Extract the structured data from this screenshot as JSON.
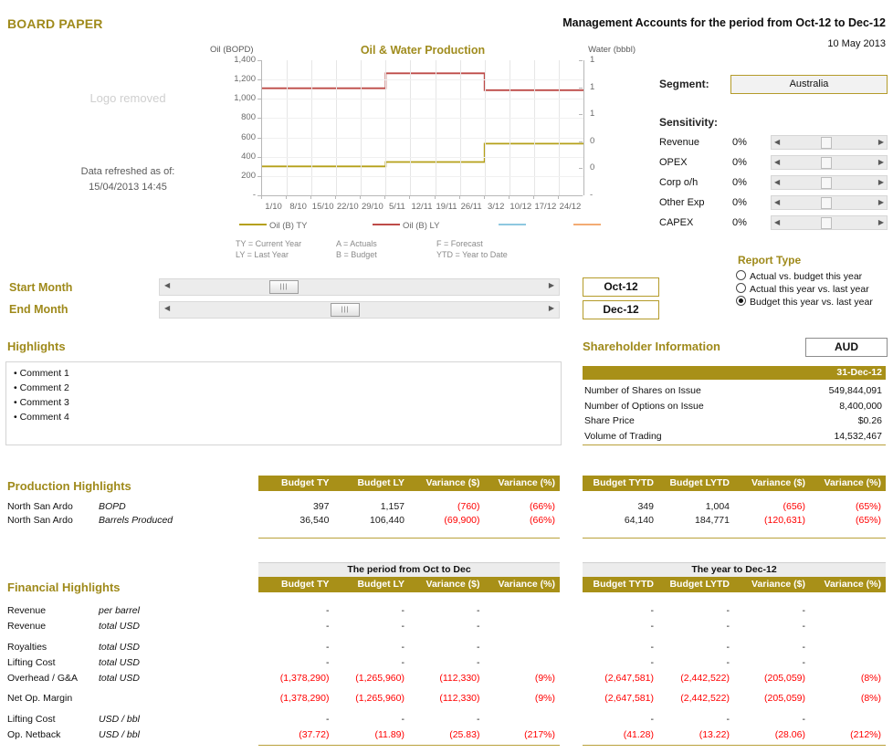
{
  "header": {
    "board_paper": "BOARD PAPER",
    "title": "Management Accounts for the period from Oct-12 to Dec-12",
    "date": "10 May 2013",
    "logo_placeholder": "Logo removed",
    "refresh_label": "Data refreshed as of:",
    "refresh_value": "15/04/2013  14:45"
  },
  "chart_data": {
    "type": "line",
    "title": "Oil & Water Production",
    "ylabel": "Oil (BOPD)",
    "y2label": "Water (bbbl)",
    "xlabel": "",
    "grid": true,
    "legend_position": "bottom",
    "ylim": [
      0,
      1400
    ],
    "yticks": [
      "1,400",
      "1,200",
      "1,000",
      "800",
      "600",
      "400",
      "200",
      "-"
    ],
    "y2ticks": [
      "1",
      "1",
      "1",
      "0",
      "0",
      "-"
    ],
    "x": [
      "1/10",
      "8/10",
      "15/10",
      "22/10",
      "29/10",
      "5/11",
      "12/11",
      "19/11",
      "26/11",
      "3/12",
      "10/12",
      "17/12",
      "24/12"
    ],
    "series": [
      {
        "name": "Oil (B) TY",
        "color": "#b5a019",
        "values": [
          300,
          300,
          300,
          300,
          300,
          345,
          345,
          345,
          345,
          535,
          535,
          535,
          535
        ]
      },
      {
        "name": "Oil (B) LY",
        "color": "#be4b48",
        "values": [
          1110,
          1110,
          1110,
          1110,
          1110,
          1265,
          1265,
          1265,
          1265,
          1090,
          1090,
          1090,
          1090
        ]
      },
      {
        "name": "",
        "color": "#8ec8e0",
        "values": []
      },
      {
        "name": "",
        "color": "#f3ab74",
        "values": []
      }
    ],
    "footnotes": [
      [
        "TY = Current Year",
        "A = Actuals",
        "F = Forecast"
      ],
      [
        "LY = Last Year",
        "B = Budget",
        "YTD = Year to Date"
      ]
    ]
  },
  "controls": {
    "segment_label": "Segment:",
    "segment_value": "Australia",
    "sensitivity_label": "Sensitivity:",
    "sensitivity": [
      {
        "name": "Revenue",
        "value": "0%"
      },
      {
        "name": "OPEX",
        "value": "0%"
      },
      {
        "name": "Corp o/h",
        "value": "0%"
      },
      {
        "name": "Other Exp",
        "value": "0%"
      },
      {
        "name": "CAPEX",
        "value": "0%"
      }
    ],
    "report_type_title": "Report Type",
    "report_types": [
      {
        "label": "Actual vs. budget this year",
        "selected": false
      },
      {
        "label": "Actual this year vs. last year",
        "selected": false
      },
      {
        "label": "Budget this year vs. last year",
        "selected": true
      }
    ],
    "start_month_label": "Start Month",
    "start_month_value": "Oct-12",
    "end_month_label": "End Month",
    "end_month_value": "Dec-12"
  },
  "highlights": {
    "title": "Highlights",
    "items": [
      "• Comment 1",
      "• Comment 2",
      "• Comment 3",
      "• Comment 4"
    ]
  },
  "shareholder": {
    "title": "Shareholder Information",
    "currency": "AUD",
    "as_at": "31-Dec-12",
    "rows": [
      {
        "label": "Number of Shares on Issue",
        "value": "549,844,091"
      },
      {
        "label": "Number of Options on Issue",
        "value": "8,400,000"
      },
      {
        "label": "Share Price",
        "value": "$0.26"
      },
      {
        "label": "Volume of Trading",
        "value": "14,532,467"
      }
    ]
  },
  "production": {
    "title": "Production Highlights",
    "left_headers": [
      "Budget TY",
      "Budget LY",
      "Variance ($)",
      "Variance (%)"
    ],
    "right_headers": [
      "Budget TYTD",
      "Budget LYTD",
      "Variance ($)",
      "Variance (%)"
    ],
    "rows": [
      {
        "label": "North San Ardo",
        "unit": "BOPD",
        "left": [
          "397",
          "1,157",
          "(760)",
          "(66%)"
        ],
        "right": [
          "349",
          "1,004",
          "(656)",
          "(65%)"
        ],
        "left_neg": [
          false,
          false,
          true,
          true
        ],
        "right_neg": [
          false,
          false,
          true,
          true
        ]
      },
      {
        "label": "North San Ardo",
        "unit": "Barrels Produced",
        "left": [
          "36,540",
          "106,440",
          "(69,900)",
          "(66%)"
        ],
        "right": [
          "64,140",
          "184,771",
          "(120,631)",
          "(65%)"
        ],
        "left_neg": [
          false,
          false,
          true,
          true
        ],
        "right_neg": [
          false,
          false,
          true,
          true
        ]
      }
    ]
  },
  "financial": {
    "title": "Financial Highlights",
    "left_band": "The period from Oct to Dec",
    "right_band": "The year to Dec-12",
    "left_headers": [
      "Budget TY",
      "Budget LY",
      "Variance ($)",
      "Variance (%)"
    ],
    "right_headers": [
      "Budget TYTD",
      "Budget LYTD",
      "Variance ($)",
      "Variance (%)"
    ],
    "rows": [
      {
        "label": "Revenue",
        "unit": "per barrel",
        "left": [
          "-",
          "-",
          "-",
          ""
        ],
        "right": [
          "-",
          "-",
          "-",
          ""
        ],
        "left_neg": [
          false,
          false,
          false,
          false
        ],
        "right_neg": [
          false,
          false,
          false,
          false
        ]
      },
      {
        "label": "Revenue",
        "unit": "total USD",
        "left": [
          "-",
          "-",
          "-",
          ""
        ],
        "right": [
          "-",
          "-",
          "-",
          ""
        ],
        "left_neg": [
          false,
          false,
          false,
          false
        ],
        "right_neg": [
          false,
          false,
          false,
          false
        ]
      },
      {
        "label": "Royalties",
        "unit": "total USD",
        "left": [
          "-",
          "-",
          "-",
          ""
        ],
        "right": [
          "-",
          "-",
          "-",
          ""
        ],
        "left_neg": [
          false,
          false,
          false,
          false
        ],
        "right_neg": [
          false,
          false,
          false,
          false
        ]
      },
      {
        "label": "Lifting Cost",
        "unit": "total USD",
        "left": [
          "-",
          "-",
          "-",
          ""
        ],
        "right": [
          "-",
          "-",
          "-",
          ""
        ],
        "left_neg": [
          false,
          false,
          false,
          false
        ],
        "right_neg": [
          false,
          false,
          false,
          false
        ]
      },
      {
        "label": "Overhead / G&A",
        "unit": "total USD",
        "left": [
          "(1,378,290)",
          "(1,265,960)",
          "(112,330)",
          "(9%)"
        ],
        "right": [
          "(2,647,581)",
          "(2,442,522)",
          "(205,059)",
          "(8%)"
        ],
        "left_neg": [
          true,
          true,
          true,
          true
        ],
        "right_neg": [
          true,
          true,
          true,
          true
        ]
      },
      {
        "label": "Net Op. Margin",
        "unit": "",
        "left": [
          "(1,378,290)",
          "(1,265,960)",
          "(112,330)",
          "(9%)"
        ],
        "right": [
          "(2,647,581)",
          "(2,442,522)",
          "(205,059)",
          "(8%)"
        ],
        "left_neg": [
          true,
          true,
          true,
          true
        ],
        "right_neg": [
          true,
          true,
          true,
          true
        ]
      },
      {
        "label": "Lifting Cost",
        "unit": "USD / bbl",
        "left": [
          "-",
          "-",
          "-",
          ""
        ],
        "right": [
          "-",
          "-",
          "-",
          ""
        ],
        "left_neg": [
          false,
          false,
          false,
          false
        ],
        "right_neg": [
          false,
          false,
          false,
          false
        ]
      },
      {
        "label": "Op. Netback",
        "unit": "USD / bbl",
        "left": [
          "(37.72)",
          "(11.89)",
          "(25.83)",
          "(217%)"
        ],
        "right": [
          "(41.28)",
          "(13.22)",
          "(28.06)",
          "(212%)"
        ],
        "left_neg": [
          true,
          true,
          true,
          true
        ],
        "right_neg": [
          true,
          true,
          true,
          true
        ]
      }
    ]
  }
}
